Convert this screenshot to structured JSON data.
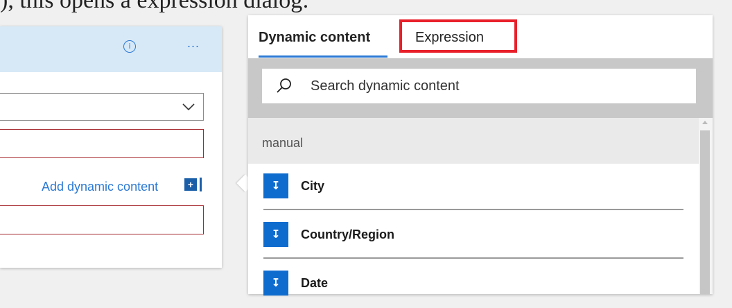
{
  "background_text": "), this opens a expression dialog:",
  "colors": {
    "accent": "#2b79d4",
    "header_bg": "#d7e9f7",
    "error_border": "#a4262c",
    "highlight": "#e8202a",
    "badge": "#0f6ccf"
  },
  "left_card": {
    "info_icon": "i",
    "info_icon_name": "info-icon",
    "more_label": "...",
    "dropdown_icon": "chevron-down-icon",
    "add_dynamic_label": "Add dynamic content",
    "add_dynamic_icon": "+"
  },
  "panel": {
    "tabs": [
      {
        "label": "Dynamic content",
        "active": true
      },
      {
        "label": "Expression",
        "active": false,
        "highlighted": true
      }
    ],
    "search": {
      "placeholder": "Search dynamic content",
      "icon": "search-icon"
    },
    "section_label": "manual",
    "items": [
      {
        "label": "City",
        "icon": "manual-trigger-icon",
        "icon_glyph": "↧"
      },
      {
        "label": "Country/Region",
        "icon": "manual-trigger-icon",
        "icon_glyph": "↧"
      },
      {
        "label": "Date",
        "icon": "manual-trigger-icon",
        "icon_glyph": "↧"
      }
    ]
  }
}
